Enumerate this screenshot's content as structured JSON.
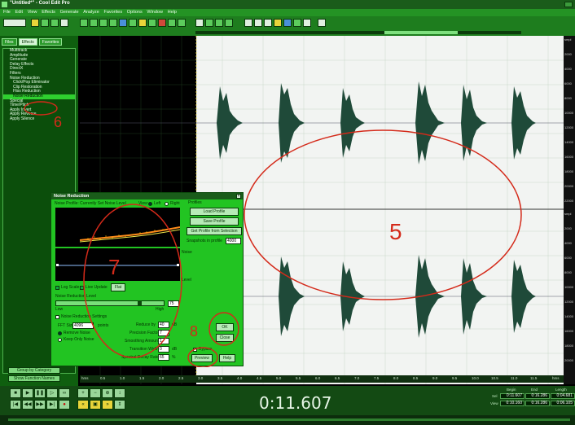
{
  "app": {
    "title": "\"Untitled*\" - Cool Edit Pro"
  },
  "menu": [
    "File",
    "Edit",
    "View",
    "Effects",
    "Generate",
    "Analyze",
    "Favorites",
    "Options",
    "Window",
    "Help"
  ],
  "organizer": {
    "tabs": [
      "Files",
      "Effects",
      "Favorites"
    ],
    "active_tab": "Effects",
    "tree": [
      {
        "label": "Multitrack",
        "level": 1
      },
      {
        "label": "Amplitude",
        "level": 1
      },
      {
        "label": "Generate",
        "level": 1
      },
      {
        "label": "Delay Effects",
        "level": 1
      },
      {
        "label": "DirectX",
        "level": 1
      },
      {
        "label": "Filters",
        "level": 1
      },
      {
        "label": "Noise Reduction",
        "level": 1
      },
      {
        "label": "Click/Pop Eliminator",
        "level": 2
      },
      {
        "label": "Clip Restoration",
        "level": 2
      },
      {
        "label": "Hiss Reduction",
        "level": 2
      },
      {
        "label": "Noise Reduction",
        "level": 2,
        "selected": true
      },
      {
        "label": "Special",
        "level": 1
      },
      {
        "label": "Time/Pitch",
        "level": 1
      },
      {
        "label": "Apply Invert",
        "level": 1
      },
      {
        "label": "Apply Reverse",
        "level": 1
      },
      {
        "label": "Apply Silence",
        "level": 1
      }
    ],
    "bottom_buttons": [
      "Group by Category",
      "Show Function Names"
    ]
  },
  "annotations": {
    "num5": "5",
    "num6": "6",
    "num7": "7",
    "num8": "8",
    "num9": "9"
  },
  "ruler_labels": [
    "smpl",
    "2000",
    "4000",
    "6000",
    "8000",
    "10000",
    "12000",
    "14000",
    "16000",
    "18000",
    "20000",
    "22000",
    "smpl",
    "2000",
    "4000",
    "6000",
    "8000",
    "10000",
    "12000",
    "14000",
    "16000",
    "18000",
    "20000"
  ],
  "timeline_labels": [
    "hms",
    "0.5",
    "1.0",
    "1.5",
    "2.0",
    "2.5",
    "3.0",
    "3.5",
    "4.0",
    "4.5",
    "5.0",
    "5.5",
    "6.0",
    "6.5",
    "7.0",
    "7.5",
    "8.0",
    "8.5",
    "9.0",
    "9.5",
    "10.0",
    "10.5",
    "11.0",
    "11.5",
    "hms"
  ],
  "noise_dialog": {
    "title": "Noise Reduction",
    "profile_label": "Noise Profile: Currently Set Noise Level",
    "view_label": "View:",
    "view_left": "Left",
    "view_right": "Right",
    "profiles_label": "Profiles",
    "load_profile": "Load Profile",
    "save_profile": "Save Profile",
    "get_profile": "Get Profile from Selection",
    "snapshots_label": "Snapshots in profile",
    "snapshots_value": "4000",
    "noise_label": "Noise",
    "level_label": "Level",
    "log_scale": "Log Scale",
    "live_update": "Live Update",
    "flat_button": "Flat",
    "reduction_level_label": "Noise Reduction Level",
    "low_label": "Low",
    "high_label": "High",
    "reduction_value": "75",
    "settings_label": "Noise Reduction Settings",
    "fft_size_label": "FFT Size",
    "fft_size_value": "4096",
    "points_label": "points",
    "reduce_by_label": "Reduce by",
    "reduce_by_value": "40",
    "db_label": "dB",
    "remove_noise": "Remove Noise",
    "keep_only_noise": "Keep Only Noise",
    "precision_label": "Precision Factor",
    "precision_value": "7",
    "smoothing_label": "Smoothing Amount",
    "smoothing_value": "1",
    "transition_label": "Transition Width",
    "transition_value": "0",
    "spectral_label": "Spectral Decay Rate",
    "spectral_value": "65",
    "percent_label": "%",
    "bypass_label": "Bypass",
    "ok": "OK",
    "close": "Close",
    "help": "Help",
    "preview": "Preview"
  },
  "transport": {
    "time": "0:11.607",
    "columns": [
      "Begin",
      "End",
      "Length"
    ],
    "rows": [
      {
        "label": "Sel",
        "begin": "0:11.607",
        "end": "0:16.286",
        "length": "0:04.681"
      },
      {
        "label": "View",
        "begin": "0:10.160",
        "end": "0:16.286",
        "length": "0:06.105"
      }
    ]
  },
  "colors": {
    "frame": "#1e7d1e",
    "dialog": "#22c422",
    "waveform": "#1f4a39",
    "annotation": "#d42a1a"
  }
}
